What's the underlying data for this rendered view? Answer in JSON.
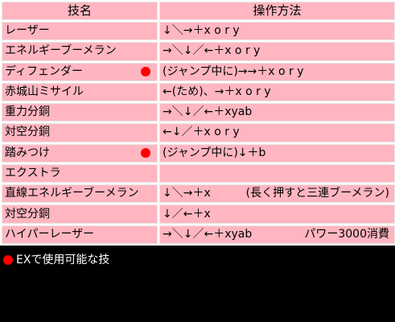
{
  "table": {
    "header": {
      "name": "技名",
      "ops": "操作方法"
    },
    "rows": [
      {
        "name": "レーザー",
        "ops": "↓＼→＋x o r y",
        "note": "",
        "ex": false
      },
      {
        "name": "エネルギーブーメラン",
        "ops": "→＼↓／←＋x o r y",
        "note": "",
        "ex": false
      },
      {
        "name": "ディフェンダー",
        "ops": "(ジャンプ中に)→→＋x o r y",
        "note": "",
        "ex": true
      },
      {
        "name": "赤城山ミサイル",
        "ops": "←(ため)、→＋x o r y",
        "note": "",
        "ex": false
      },
      {
        "name": "重力分銅",
        "ops": "→＼↓／←＋xyab",
        "note": "",
        "ex": false
      },
      {
        "name": "対空分銅",
        "ops": "←↓／＋x o r y",
        "note": "",
        "ex": false
      },
      {
        "name": "踏みつけ",
        "ops": "(ジャンプ中に)↓＋b",
        "note": "",
        "ex": true
      },
      {
        "name": "エクストラ",
        "ops": "",
        "note": "",
        "ex": false
      },
      {
        "name": "直線エネルギーブーメラン",
        "ops": "↓＼→＋x",
        "note": "(長く押すと三連ブーメラン)",
        "ex": false
      },
      {
        "name": "対空分銅",
        "ops": "↓／←＋x",
        "note": "",
        "ex": false
      },
      {
        "name": "ハイパーレーザー",
        "ops": "→＼↓／←＋xyab",
        "note": "パワー3000消費",
        "ex": false
      }
    ]
  },
  "legend": {
    "text": "EXで使用可能な技"
  },
  "colors": {
    "cell_bg": "#ffb6c1",
    "ex_dot": "#ff0000",
    "page_bg": "#000000"
  }
}
